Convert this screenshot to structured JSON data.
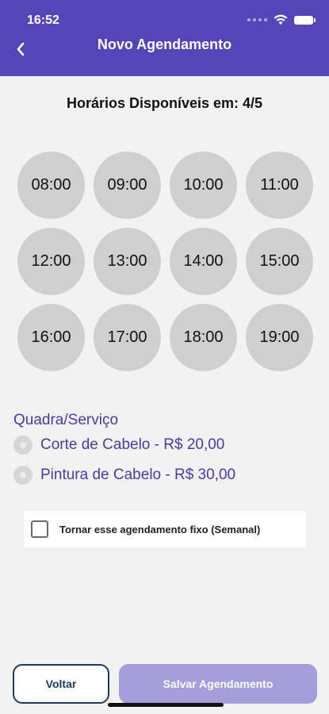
{
  "status_bar": {
    "time": "16:52"
  },
  "header": {
    "title": "Novo Agendamento"
  },
  "availability": {
    "title": "Horários Disponíveis em: 4/5"
  },
  "time_slots": [
    "08:00",
    "09:00",
    "10:00",
    "11:00",
    "12:00",
    "13:00",
    "14:00",
    "15:00",
    "16:00",
    "17:00",
    "18:00",
    "19:00"
  ],
  "service": {
    "title": "Quadra/Serviço",
    "options": [
      "Corte de Cabelo - R$ 20,00",
      "Pintura de Cabelo - R$ 30,00"
    ]
  },
  "fixed_schedule": {
    "label": "Tornar esse agendamento fixo (Semanal)",
    "checked": false
  },
  "footer": {
    "back_label": "Voltar",
    "save_label": "Salvar Agendamento"
  },
  "colors": {
    "header": "#5645b8",
    "accent_text": "#4a3aa6",
    "save_button": "#a69ddd",
    "back_border": "#1c3a5e"
  }
}
